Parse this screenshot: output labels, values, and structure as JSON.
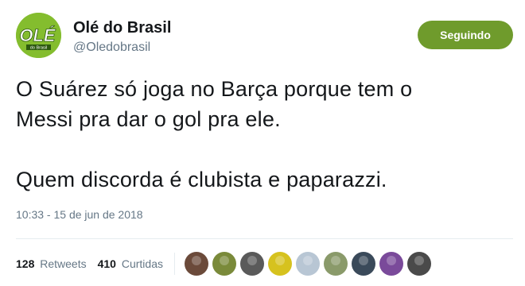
{
  "account": {
    "name": "Olé do Brasil",
    "handle": "@Oledobrasil",
    "avatar_text": "OLÉ",
    "avatar_subtext": "do Brasil"
  },
  "follow_button": {
    "label": "Seguindo",
    "color": "#6f9b2c"
  },
  "tweet": {
    "line1": "O Suárez só joga no Barça porque tem o",
    "line2": "Messi pra dar o gol pra ele.",
    "line3": "Quem discorda é clubista e paparazzi."
  },
  "timestamp": "10:33 - 15 de jun de 2018",
  "stats": {
    "retweets_count": "128",
    "retweets_label": "Retweets",
    "likes_count": "410",
    "likes_label": "Curtidas"
  },
  "liker_avatars": [
    {
      "icon": "user-avatar-icon",
      "color": "#6b4a3a"
    },
    {
      "icon": "user-avatar-icon",
      "color": "#7a8a3a"
    },
    {
      "icon": "user-avatar-icon",
      "color": "#5a5a5a"
    },
    {
      "icon": "user-avatar-icon",
      "color": "#d6c21e"
    },
    {
      "icon": "default-avatar-icon",
      "color": "#b8c6d4"
    },
    {
      "icon": "user-avatar-icon",
      "color": "#8a9a6a"
    },
    {
      "icon": "user-avatar-icon",
      "color": "#3a4a5a"
    },
    {
      "icon": "user-avatar-icon",
      "color": "#7a4a9a"
    },
    {
      "icon": "user-avatar-icon",
      "color": "#4a4a4a"
    }
  ],
  "colors": {
    "text": "#14171a",
    "secondary": "#657786",
    "divider": "#e6ecf0",
    "brand_green": "#84bd2e"
  }
}
